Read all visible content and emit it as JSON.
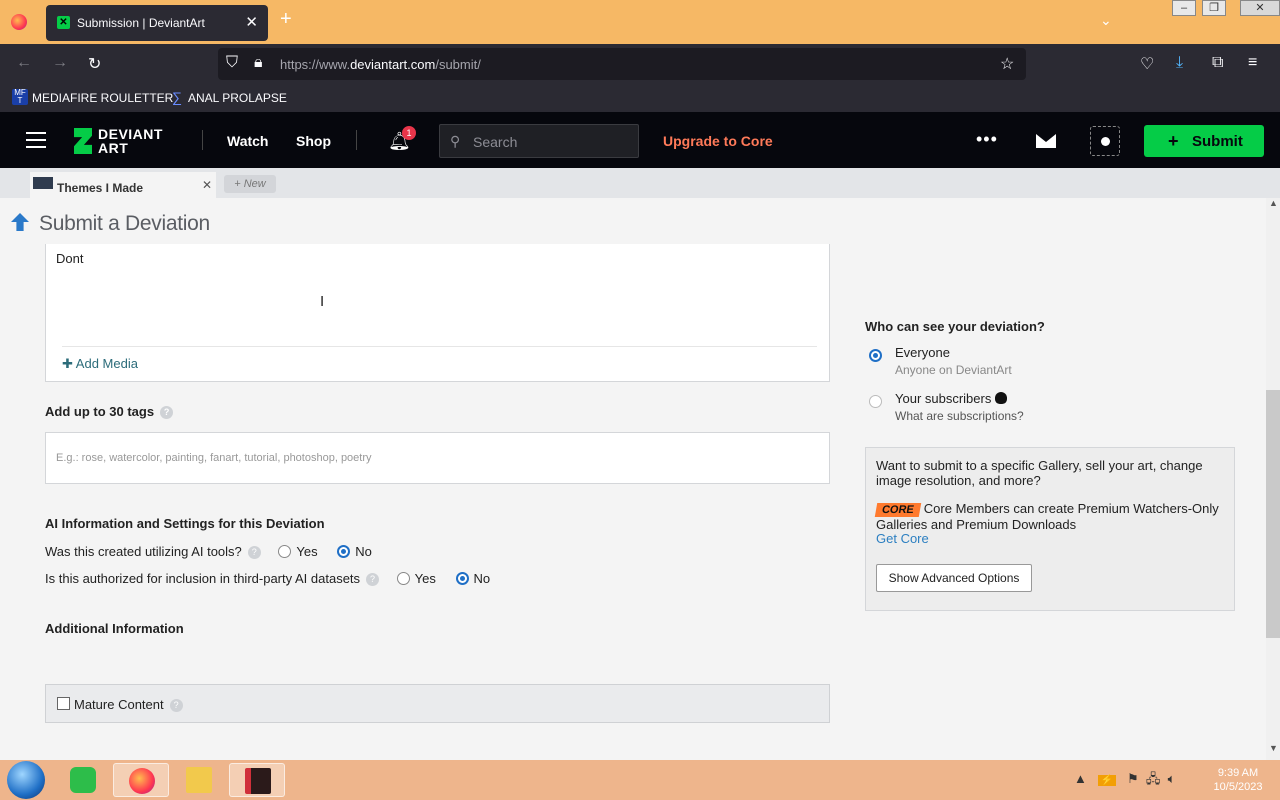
{
  "browser": {
    "tab_title": "Submission | DeviantArt",
    "tab_close": "✕",
    "new_tab": "+",
    "url_prefix": "https://www.",
    "url_domain": "deviantart.com",
    "url_path": "/submit/",
    "bookmarks": [
      {
        "label": "MEDIAFIRE ROULETTER"
      },
      {
        "label": "ANAL PROLAPSE"
      }
    ]
  },
  "header": {
    "logo_line1": "DEVIANT",
    "logo_line2": "ART",
    "watch": "Watch",
    "shop": "Shop",
    "notif_count": "1",
    "search_placeholder": "Search",
    "upgrade": "Upgrade to Core",
    "more": "•••",
    "submit": "Submit"
  },
  "stash": {
    "tab_label": "Themes I Made",
    "tab_close": "✕",
    "new_label": "+ New"
  },
  "page": {
    "title": "Submit a Deviation",
    "description_text": "Dont",
    "add_media": "Add Media",
    "tags_label": "Add up to 30 tags",
    "tags_placeholder": "E.g.: rose, watercolor, painting, fanart, tutorial, photoshop, poetry",
    "ai_section": "AI Information and Settings for this Deviation",
    "ai_q1": "Was this created utilizing AI tools?",
    "ai_q2": "Is this authorized for inclusion in third-party AI datasets",
    "yes": "Yes",
    "no": "No",
    "ai_q1_value": "No",
    "ai_q2_value": "No",
    "additional_info": "Additional Information",
    "mature_content": "Mature Content"
  },
  "visibility": {
    "title": "Who can see your deviation?",
    "options": [
      {
        "label": "Everyone",
        "sub": "Anyone on DeviantArt",
        "selected": true
      },
      {
        "label": "Your subscribers",
        "sub": "What are subscriptions?",
        "selected": false
      }
    ]
  },
  "advanced": {
    "intro": "Want to submit to a specific Gallery, sell your art, change image resolution, and more?",
    "core_badge": "CORE",
    "core_text": "Core Members can create Premium Watchers-Only Galleries and Premium Downloads",
    "get_core": "Get Core",
    "button": "Show Advanced Options"
  },
  "taskbar": {
    "time": "9:39 AM",
    "date": "10/5/2023"
  },
  "colors": {
    "accent_green": "#05cc47",
    "upgrade_orange": "#ff7a59",
    "radio_blue": "#1f6fc6"
  }
}
